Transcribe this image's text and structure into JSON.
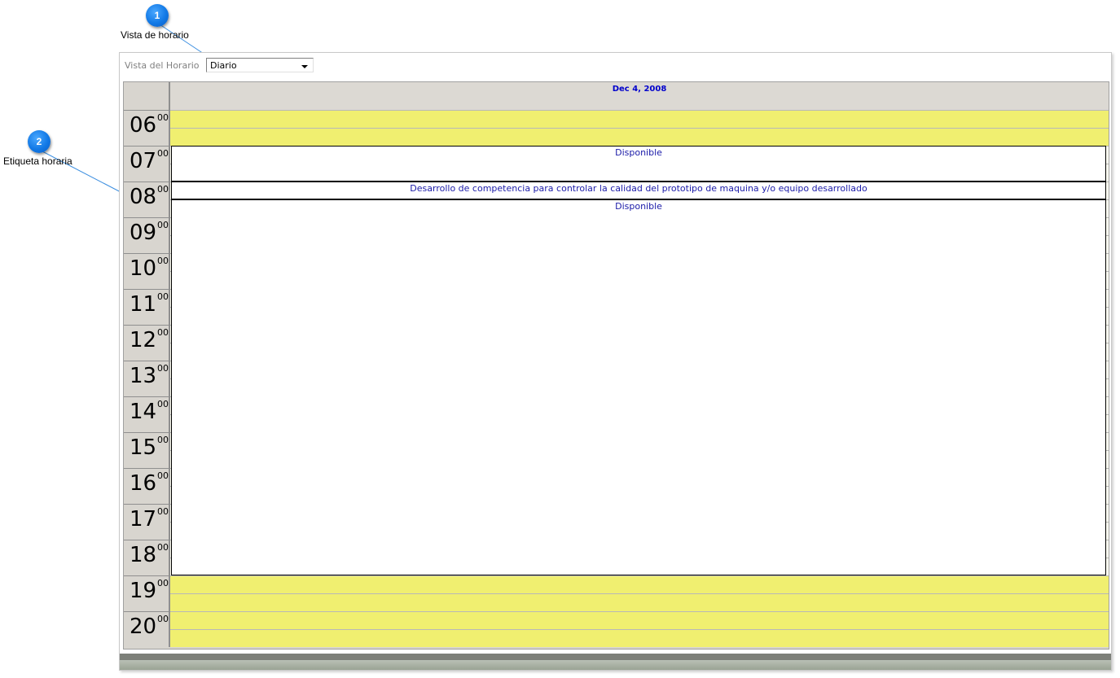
{
  "callouts": [
    {
      "number": "1",
      "label": "Vista de horario"
    },
    {
      "number": "2",
      "label": "Etiqueta horaria"
    }
  ],
  "toolbar": {
    "view_label": "Vista del Horario",
    "view_value": "Diario"
  },
  "schedule": {
    "date": "Dec 4, 2008",
    "minutes_suffix": "00",
    "hours": [
      "06",
      "07",
      "08",
      "09",
      "10",
      "11",
      "12",
      "13",
      "14",
      "15",
      "16",
      "17",
      "18",
      "19",
      "20"
    ],
    "events": [
      {
        "title": "Disponible",
        "start": "07:00",
        "end": "08:00"
      },
      {
        "title": "Desarrollo de competencia para controlar la calidad del prototipo de maquina y/o equipo desarrollado",
        "start": "08:00",
        "end": "08:30"
      },
      {
        "title": "Disponible",
        "start": "08:30",
        "end": "19:00"
      }
    ]
  },
  "colors": {
    "off_hours": "#f0ef70",
    "header_bg": "#dcd9d3",
    "event_text": "#1a1aa8",
    "callout": "#1279e6"
  }
}
